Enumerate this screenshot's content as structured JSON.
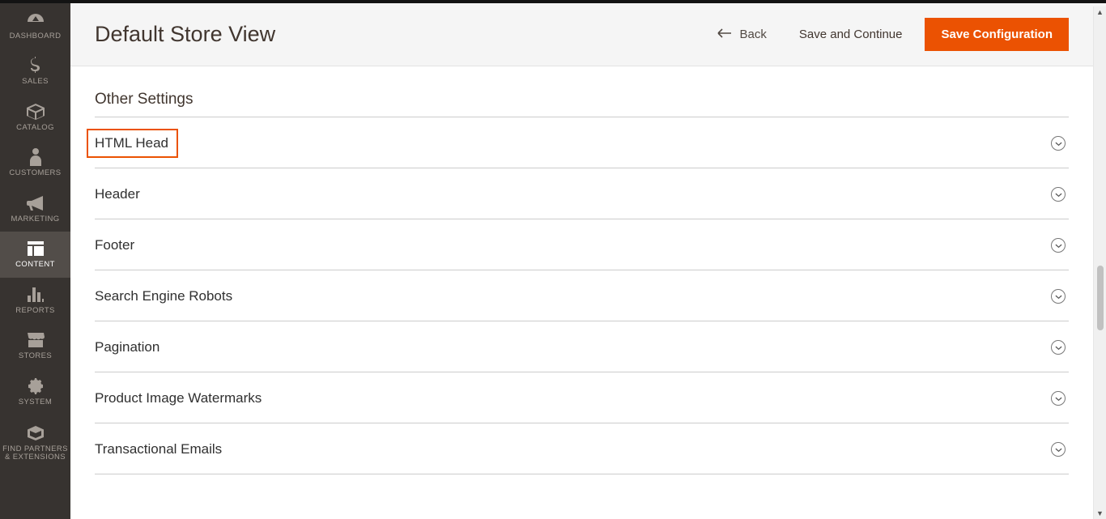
{
  "sidebar": {
    "items": [
      {
        "id": "dashboard",
        "label": "DASHBOARD",
        "icon": "gauge"
      },
      {
        "id": "sales",
        "label": "SALES",
        "icon": "dollar"
      },
      {
        "id": "catalog",
        "label": "CATALOG",
        "icon": "box"
      },
      {
        "id": "customers",
        "label": "CUSTOMERS",
        "icon": "person"
      },
      {
        "id": "marketing",
        "label": "MARKETING",
        "icon": "megaphone"
      },
      {
        "id": "content",
        "label": "CONTENT",
        "icon": "layout"
      },
      {
        "id": "reports",
        "label": "REPORTS",
        "icon": "bars"
      },
      {
        "id": "stores",
        "label": "STORES",
        "icon": "storefront"
      },
      {
        "id": "system",
        "label": "SYSTEM",
        "icon": "gear"
      },
      {
        "id": "partners",
        "label": "FIND PARTNERS & EXTENSIONS",
        "icon": "package"
      }
    ],
    "active": "content"
  },
  "header": {
    "title": "Default Store View",
    "back_label": "Back",
    "save_continue_label": "Save and Continue",
    "save_config_label": "Save Configuration"
  },
  "section": {
    "title": "Other Settings",
    "rows": [
      {
        "id": "html-head",
        "label": "HTML Head",
        "highlight": true
      },
      {
        "id": "header",
        "label": "Header"
      },
      {
        "id": "footer",
        "label": "Footer"
      },
      {
        "id": "robots",
        "label": "Search Engine Robots"
      },
      {
        "id": "pagination",
        "label": "Pagination"
      },
      {
        "id": "watermarks",
        "label": "Product Image Watermarks"
      },
      {
        "id": "emails",
        "label": "Transactional Emails"
      }
    ]
  },
  "colors": {
    "accent": "#eb5202"
  }
}
